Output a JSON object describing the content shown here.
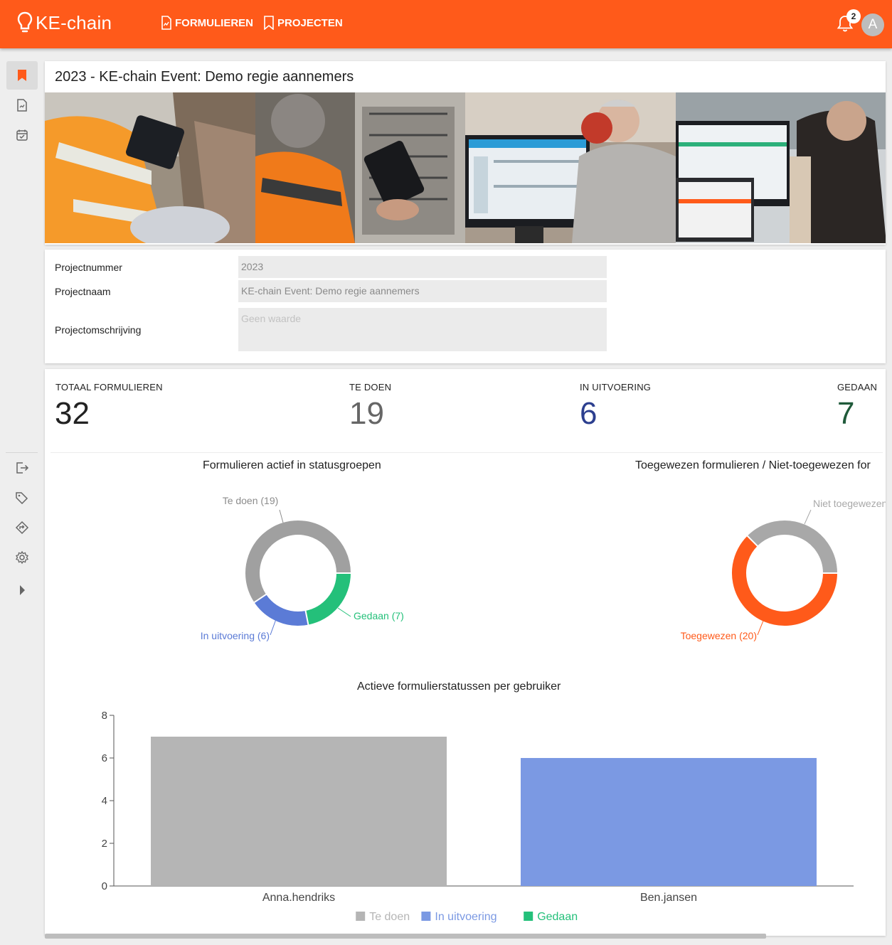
{
  "header": {
    "brand": "KE-chain",
    "nav": [
      {
        "label": "FORMULIEREN"
      },
      {
        "label": "PROJECTEN"
      }
    ],
    "notifications_count": "2",
    "avatar_initial": "A",
    "accent_color": "#ff5a1a"
  },
  "sidebar": {
    "items": [
      {
        "icon": "bookmark-icon",
        "active": true
      },
      {
        "icon": "form-icon"
      },
      {
        "icon": "calendar-check-icon"
      },
      {
        "icon": "export-icon"
      },
      {
        "icon": "tags-icon"
      },
      {
        "icon": "diamond-arrow-icon"
      },
      {
        "icon": "gear-icon"
      },
      {
        "icon": "expand-arrow-icon"
      }
    ]
  },
  "page": {
    "title": "2023 - KE-chain Event: Demo regie aannemers"
  },
  "properties": [
    {
      "label": "Projectnummer",
      "value": "2023"
    },
    {
      "label": "Projectnaam",
      "value": "KE-chain Event: Demo regie aannemers"
    },
    {
      "label": "Projectomschrijving",
      "placeholder": "Geen waarde"
    }
  ],
  "kpis": [
    {
      "label": "TOTAAL FORMULIEREN",
      "value": "32",
      "color": "#222222"
    },
    {
      "label": "TE DOEN",
      "value": "19",
      "color": "#666666"
    },
    {
      "label": "IN UITVOERING",
      "value": "6",
      "color": "#2c3f8f"
    },
    {
      "label": "GEDAAN",
      "value": "7",
      "color": "#1f5a3a"
    }
  ],
  "chart_data": [
    {
      "type": "pie",
      "title": "Formulieren actief in statusgroepen",
      "labels": [
        "Te doen (19)",
        "In uitvoering (6)",
        "Gedaan (7)"
      ],
      "values": [
        19,
        6,
        7
      ],
      "colors": [
        "#a0a0a0",
        "#5b7bd6",
        "#24c07a"
      ]
    },
    {
      "type": "pie",
      "title": "Toegewezen formulieren / Niet-toegewezen for",
      "labels": [
        "Niet toegewezen",
        "Toegewezen (20)"
      ],
      "values": [
        12,
        20
      ],
      "colors": [
        "#a8a8a8",
        "#ff5a1a"
      ]
    },
    {
      "type": "bar",
      "title": "Actieve formulierstatussen per gebruiker",
      "categories": [
        "Anna.hendriks",
        "Ben.jansen"
      ],
      "series": [
        {
          "name": "Te doen",
          "values": [
            7,
            0
          ],
          "color": "#b5b5b5"
        },
        {
          "name": "In uitvoering",
          "values": [
            0,
            6
          ],
          "color": "#7b99e3"
        },
        {
          "name": "Gedaan",
          "values": [
            0,
            0
          ],
          "color": "#24c07a"
        }
      ],
      "yticks": [
        "0",
        "2",
        "4",
        "6",
        "8"
      ],
      "ylim": [
        0,
        8
      ],
      "legend": "bottom"
    }
  ]
}
